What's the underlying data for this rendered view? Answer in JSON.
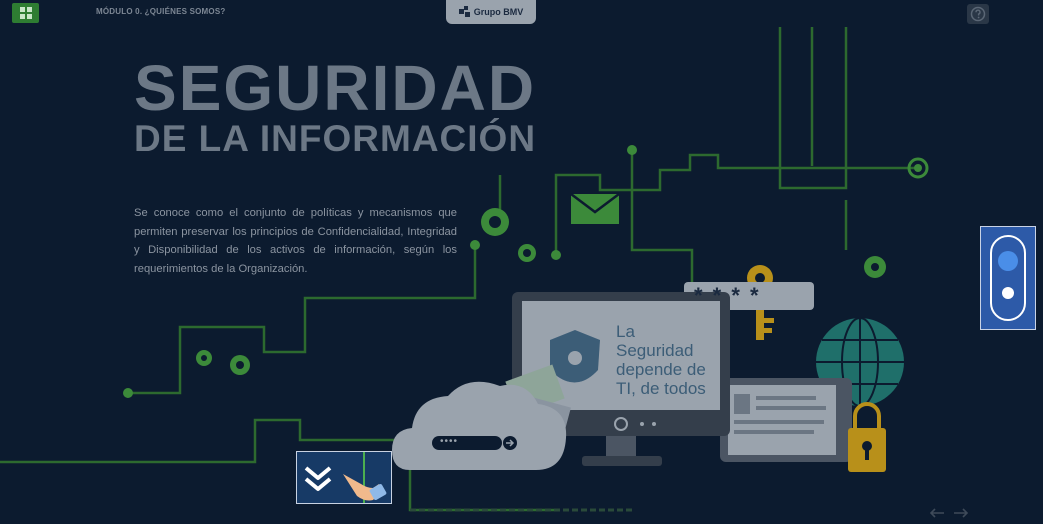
{
  "header": {
    "module_title": "MÓDULO 0. ¿QUIÉNES SOMOS?",
    "logo_text": "Grupo BMV"
  },
  "hero": {
    "title_line1": "SEGURIDAD",
    "title_line2": "DE LA INFORMACIÓN",
    "description": "Se conoce como el conjunto de políticas y mecanismos que permiten preservar los principios de Confidencialidad, Integridad y Disponibilidad de los activos de información, según los requerimientos de la Organización."
  },
  "illustration": {
    "monitor_line1": "La",
    "monitor_line2": "Seguridad",
    "monitor_line3": "depende de",
    "monitor_line4": "TI, de todos",
    "password_mask": "* * *   *",
    "cloud_mask": "••••"
  },
  "colors": {
    "background": "#0c1b2f",
    "circuit": "#3c8a3a",
    "accent_blue": "#2d5aa8",
    "menu_green": "#2e7d32"
  }
}
